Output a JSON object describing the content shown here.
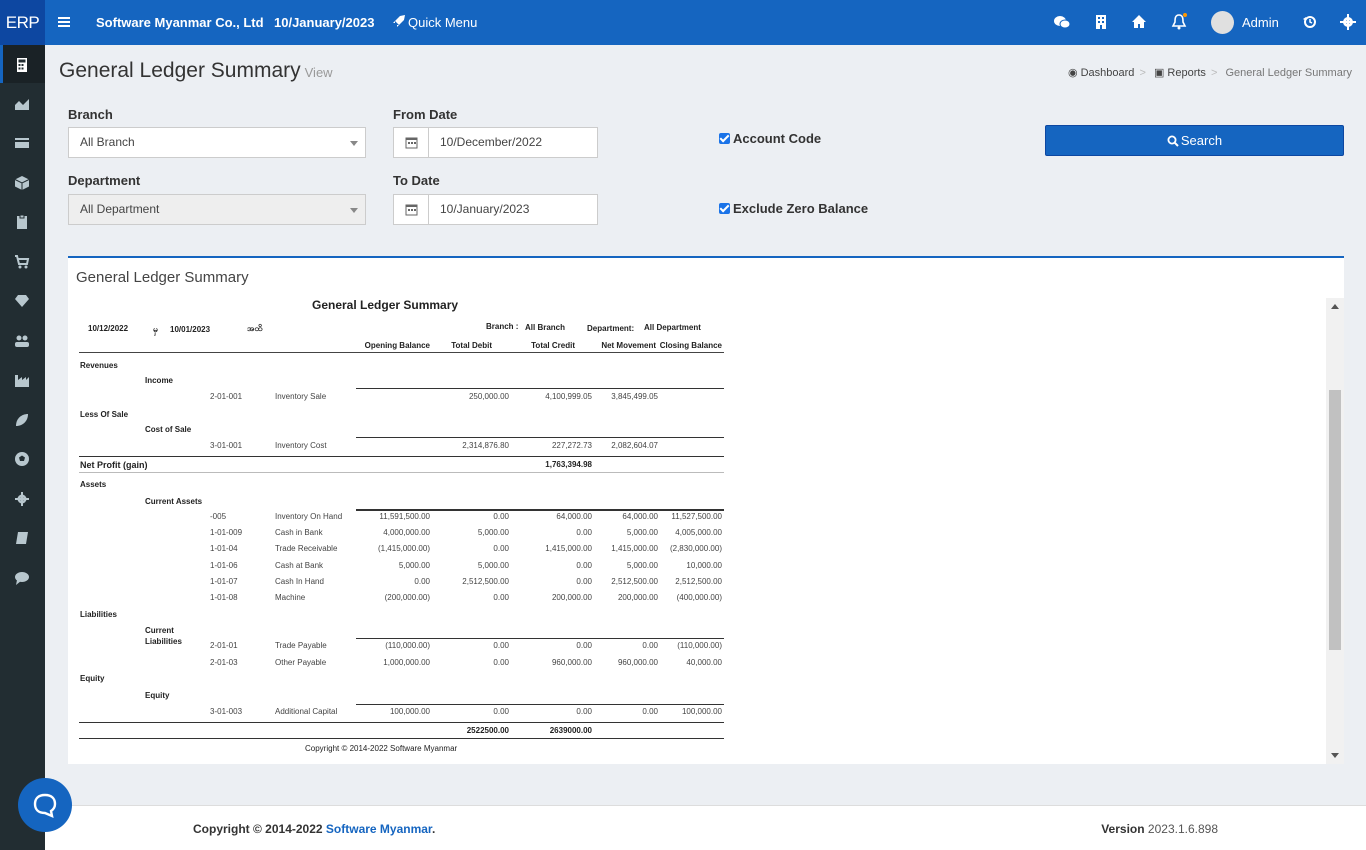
{
  "topbar": {
    "brand": "ERP",
    "company": "Software Myanmar Co., Ltd",
    "date": "10/January/2023",
    "quick_menu": "Quick Menu",
    "user": "Admin"
  },
  "page": {
    "title": "General Ledger Summary",
    "subtitle": "View",
    "breadcrumb": [
      "Dashboard",
      "Reports",
      "General Ledger Summary"
    ]
  },
  "filters": {
    "branch_label": "Branch",
    "branch_value": "All Branch",
    "department_label": "Department",
    "department_value": "All Department",
    "from_label": "From Date",
    "from_value": "10/December/2022",
    "to_label": "To Date",
    "to_value": "10/January/2023",
    "account_code": "Account Code",
    "exclude_zero": "Exclude Zero Balance",
    "search": "Search"
  },
  "panel_title": "General Ledger Summary",
  "report": {
    "title": "General Ledger Summary",
    "from": "10/12/2022",
    "mm_from": "မှ",
    "to": "10/01/2023",
    "mm_to": "အထိ",
    "branch_label": "Branch :",
    "branch": "All Branch",
    "department_label": "Department:",
    "department": "All Department",
    "columns": [
      "Opening Balance",
      "Total Debit",
      "Total Credit",
      "Net Movement",
      "Closing Balance"
    ],
    "revenues": "Revenues",
    "income": "Income",
    "less_of_sale": "Less Of Sale",
    "cost_of_sale": "Cost of Sale",
    "net_profit_label": "Net Profit (gain)",
    "net_profit": "1,763,394.98",
    "assets": "Assets",
    "current_assets": "Current Assets",
    "liabilities": "Liabilities",
    "current_liabilities_1": "Current",
    "current_liabilities_2": "Liabilities",
    "equity": "Equity",
    "equity_sub": "Equity",
    "income_rows": [
      {
        "code": "2-01-001",
        "name": "Inventory Sale",
        "ob": "",
        "dr": "250,000.00",
        "cr": "4,100,999.05",
        "nm": "3,845,499.05",
        "cb": ""
      }
    ],
    "cost_rows": [
      {
        "code": "3-01-001",
        "name": "Inventory Cost",
        "ob": "",
        "dr": "2,314,876.80",
        "cr": "227,272.73",
        "nm": "2,082,604.07",
        "cb": ""
      }
    ],
    "asset_rows": [
      {
        "code": "-005",
        "name": "Inventory On Hand",
        "ob": "11,591,500.00",
        "dr": "0.00",
        "cr": "64,000.00",
        "nm": "64,000.00",
        "cb": "11,527,500.00"
      },
      {
        "code": "1-01-009",
        "name": "Cash in Bank",
        "ob": "4,000,000.00",
        "dr": "5,000.00",
        "cr": "0.00",
        "nm": "5,000.00",
        "cb": "4,005,000.00"
      },
      {
        "code": "1-01-04",
        "name": "Trade Receivable",
        "ob": "(1,415,000.00)",
        "dr": "0.00",
        "cr": "1,415,000.00",
        "nm": "1,415,000.00",
        "cb": "(2,830,000.00)"
      },
      {
        "code": "1-01-06",
        "name": "Cash at Bank",
        "ob": "5,000.00",
        "dr": "5,000.00",
        "cr": "0.00",
        "nm": "5,000.00",
        "cb": "10,000.00"
      },
      {
        "code": "1-01-07",
        "name": "Cash In Hand",
        "ob": "0.00",
        "dr": "2,512,500.00",
        "cr": "0.00",
        "nm": "2,512,500.00",
        "cb": "2,512,500.00"
      },
      {
        "code": "1-01-08",
        "name": "Machine",
        "ob": "(200,000.00)",
        "dr": "0.00",
        "cr": "200,000.00",
        "nm": "200,000.00",
        "cb": "(400,000.00)"
      }
    ],
    "liability_rows": [
      {
        "code": "2-01-01",
        "name": "Trade Payable",
        "ob": "(110,000.00)",
        "dr": "0.00",
        "cr": "0.00",
        "nm": "0.00",
        "cb": "(110,000.00)"
      },
      {
        "code": "2-01-03",
        "name": "Other Payable",
        "ob": "1,000,000.00",
        "dr": "0.00",
        "cr": "960,000.00",
        "nm": "960,000.00",
        "cb": "40,000.00"
      }
    ],
    "equity_rows": [
      {
        "code": "3-01-003",
        "name": "Additional Capital",
        "ob": "100,000.00",
        "dr": "0.00",
        "cr": "0.00",
        "nm": "0.00",
        "cb": "100,000.00"
      }
    ],
    "total_debit": "2522500.00",
    "total_credit": "2639000.00",
    "copyright": "Copyright © 2014-2022 Software Myanmar"
  },
  "footer": {
    "copy_prefix": "Copyright © 2014-2022",
    "copy_link": "Software Myanmar",
    "copy_suffix": ".",
    "version_label": "Version",
    "version": "2023.1.6.898"
  },
  "icons": {
    "menu": "hamburger-icon",
    "quick": "rocket-icon",
    "chat": "wechat-icon",
    "building": "building-icon",
    "home": "home-icon",
    "bell": "bell-icon",
    "history": "history-icon",
    "settings": "gear-icon"
  }
}
